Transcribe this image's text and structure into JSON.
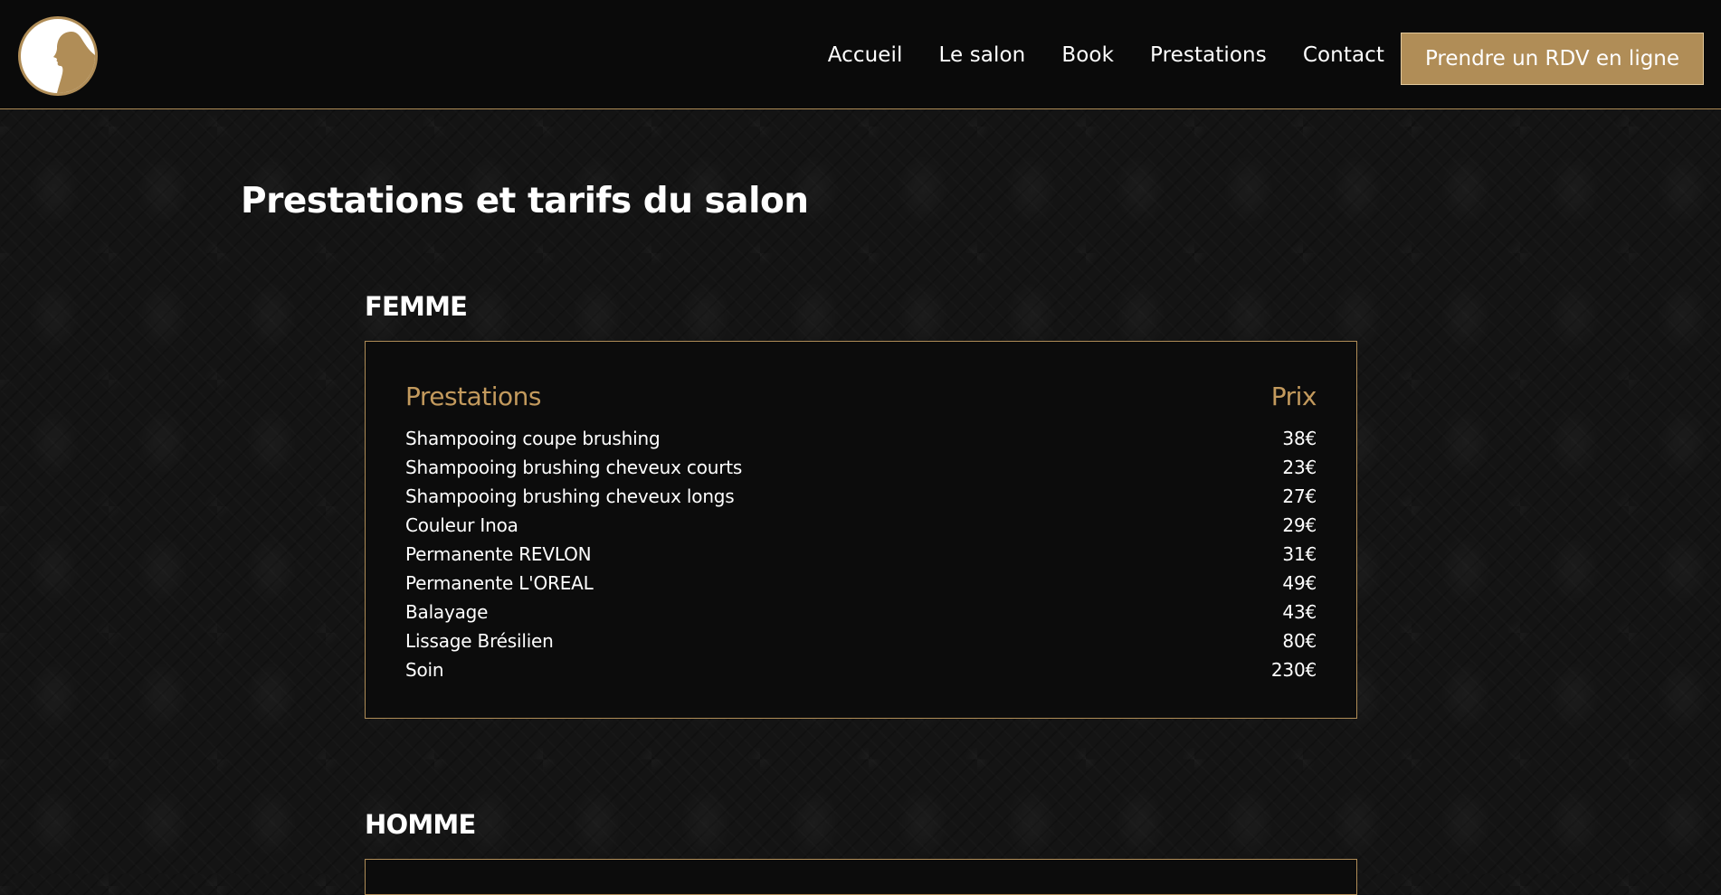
{
  "header": {
    "logo_alt": "salon logo",
    "nav": [
      "Accueil",
      "Le salon",
      "Book",
      "Prestations",
      "Contact"
    ],
    "cta_label": "Prendre un RDV en ligne"
  },
  "page": {
    "title": "Prestations et tarifs du salon"
  },
  "sections": [
    {
      "title": "FEMME",
      "col_service": "Prestations",
      "col_price": "Prix",
      "items": [
        {
          "name": "Shampooing coupe brushing",
          "price": "38€"
        },
        {
          "name": "Shampooing brushing cheveux courts",
          "price": "23€"
        },
        {
          "name": "Shampooing brushing cheveux longs",
          "price": "27€"
        },
        {
          "name": "Couleur Inoa",
          "price": "29€"
        },
        {
          "name": "Permanente REVLON",
          "price": "31€"
        },
        {
          "name": "Permanente L'OREAL",
          "price": "49€"
        },
        {
          "name": "Balayage",
          "price": "43€"
        },
        {
          "name": "Lissage Brésilien",
          "price": "80€"
        },
        {
          "name": "Soin",
          "price": "230€"
        }
      ]
    },
    {
      "title": "HOMME"
    }
  ],
  "colors": {
    "gold": "#b08d57",
    "gold_text": "#c39a5d",
    "header_bg": "#0a0a0a",
    "box_bg": "#0c0c0c"
  },
  "icons": {
    "logo": "woman-profile-icon"
  }
}
